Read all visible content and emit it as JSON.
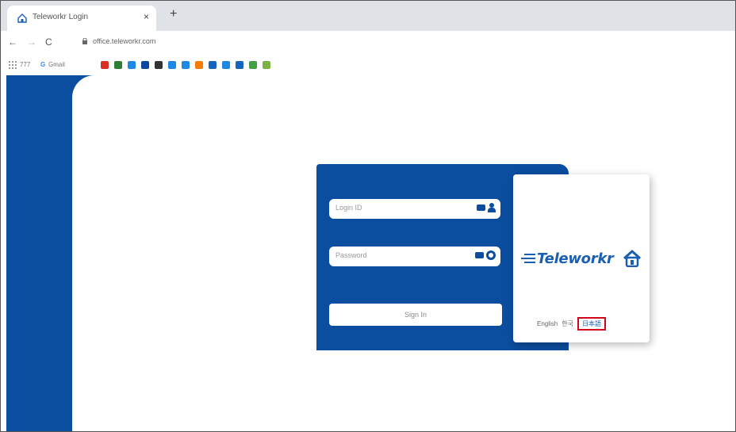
{
  "browser": {
    "tab_title": "Teleworkr Login",
    "tab_close": "×",
    "new_tab": "+",
    "back": "←",
    "forward": "→",
    "reload": "C",
    "url": "office.teleworkr.com"
  },
  "bookmarks": {
    "apps_label": "777",
    "gmail_label": "Gmail",
    "icon_colors": [
      "#d93025",
      "#2e7d32",
      "#1e88e5",
      "#0d47a1",
      "#333333",
      "#1e88e5",
      "#1e88e5",
      "#f57c00",
      "#1565c0",
      "#1e88e5",
      "#1565c0",
      "#43a047",
      "#7cb342"
    ]
  },
  "login": {
    "login_id_placeholder": "Login ID",
    "password_placeholder": "Password",
    "signin_label": "Sign In"
  },
  "brand": {
    "name": "Teleworkr"
  },
  "language": {
    "english": "English",
    "option2": "한국",
    "option3": "日本語"
  },
  "colors": {
    "brand_blue": "#0b4d9f",
    "highlight_red": "#d0021b"
  }
}
